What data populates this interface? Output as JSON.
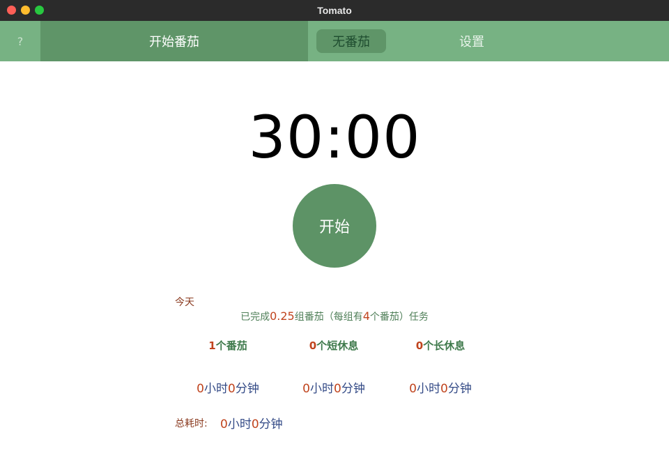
{
  "window": {
    "title": "Tomato"
  },
  "tabs": {
    "help": "?",
    "start": "开始番茄",
    "none": "无番茄",
    "settings": "设置"
  },
  "timer": {
    "display": "30:00"
  },
  "start_button": {
    "label": "开始"
  },
  "stats": {
    "today_label": "今天",
    "summary_prefix": "已完成",
    "groups_completed": "0.25",
    "summary_mid": "组番茄（每组有",
    "per_group": "4",
    "summary_suffix": "个番茄）任务",
    "tomato_count": "1",
    "tomato_label": "个番茄",
    "short_break_count": "0",
    "short_break_label": "个短休息",
    "long_break_count": "0",
    "long_break_label": "个长休息",
    "hour_unit": "小时",
    "minute_unit": "分钟",
    "tomato_time": {
      "hours": "0",
      "minutes": "0"
    },
    "short_break_time": {
      "hours": "0",
      "minutes": "0"
    },
    "long_break_time": {
      "hours": "0",
      "minutes": "0"
    },
    "total_label": "总耗时:",
    "total_time": {
      "hours": "0",
      "minutes": "0"
    }
  },
  "colors": {
    "tab_bar": "#77b283",
    "tab_active": "#5f9568",
    "start_button": "#5d9366",
    "number_accent": "#c0441e"
  }
}
